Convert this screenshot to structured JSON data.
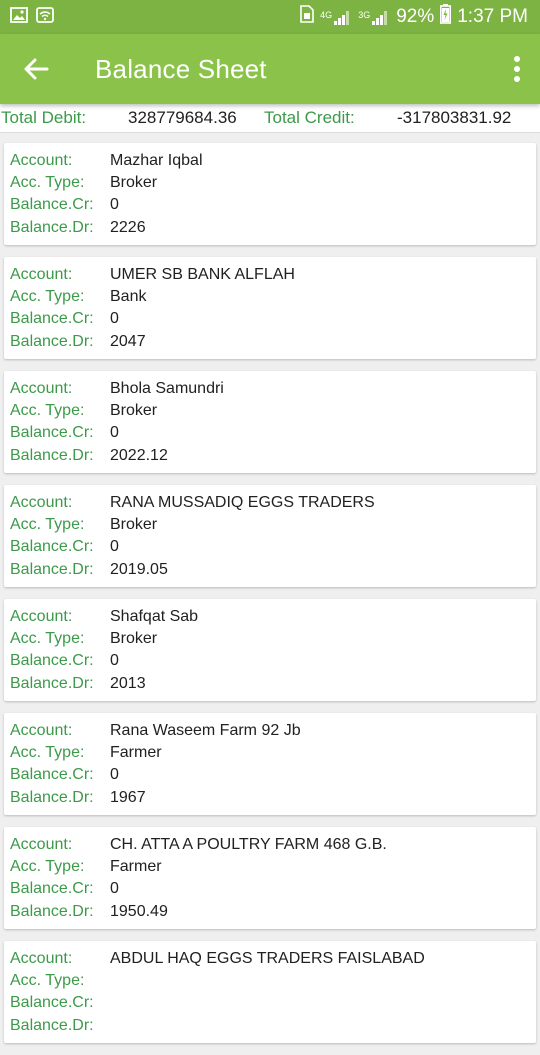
{
  "status_bar": {
    "network_4g": "4G",
    "network_3g": "3G",
    "battery": "92%",
    "time": "1:37 PM"
  },
  "app_bar": {
    "title": "Balance Sheet"
  },
  "totals": {
    "debit_label": "Total Debit:",
    "debit_value": "328779684.36",
    "credit_label": "Total Credit:",
    "credit_value": "-317803831.92"
  },
  "labels": {
    "account": "Account:",
    "acc_type": "Acc. Type:",
    "balance_cr": "Balance.Cr:",
    "balance_dr": "Balance.Dr:"
  },
  "accounts": [
    {
      "account": "Mazhar Iqbal",
      "type": "Broker",
      "cr": "0",
      "dr": "2226"
    },
    {
      "account": "UMER SB BANK ALFLAH",
      "type": "Bank",
      "cr": "0",
      "dr": "2047"
    },
    {
      "account": "Bhola Samundri",
      "type": "Broker",
      "cr": "0",
      "dr": "2022.12"
    },
    {
      "account": "RANA MUSSADIQ EGGS TRADERS",
      "type": "Broker",
      "cr": "0",
      "dr": "2019.05"
    },
    {
      "account": "Shafqat Sab",
      "type": "Broker",
      "cr": "0",
      "dr": "2013"
    },
    {
      "account": "Rana Waseem Farm 92 Jb",
      "type": "Farmer",
      "cr": "0",
      "dr": "1967"
    },
    {
      "account": "CH. ATTA A POULTRY FARM 468 G.B.",
      "type": "Farmer",
      "cr": "0",
      "dr": "1950.49"
    },
    {
      "account": "ABDUL HAQ EGGS TRADERS FAISLABAD",
      "type": "",
      "cr": "",
      "dr": ""
    }
  ]
}
